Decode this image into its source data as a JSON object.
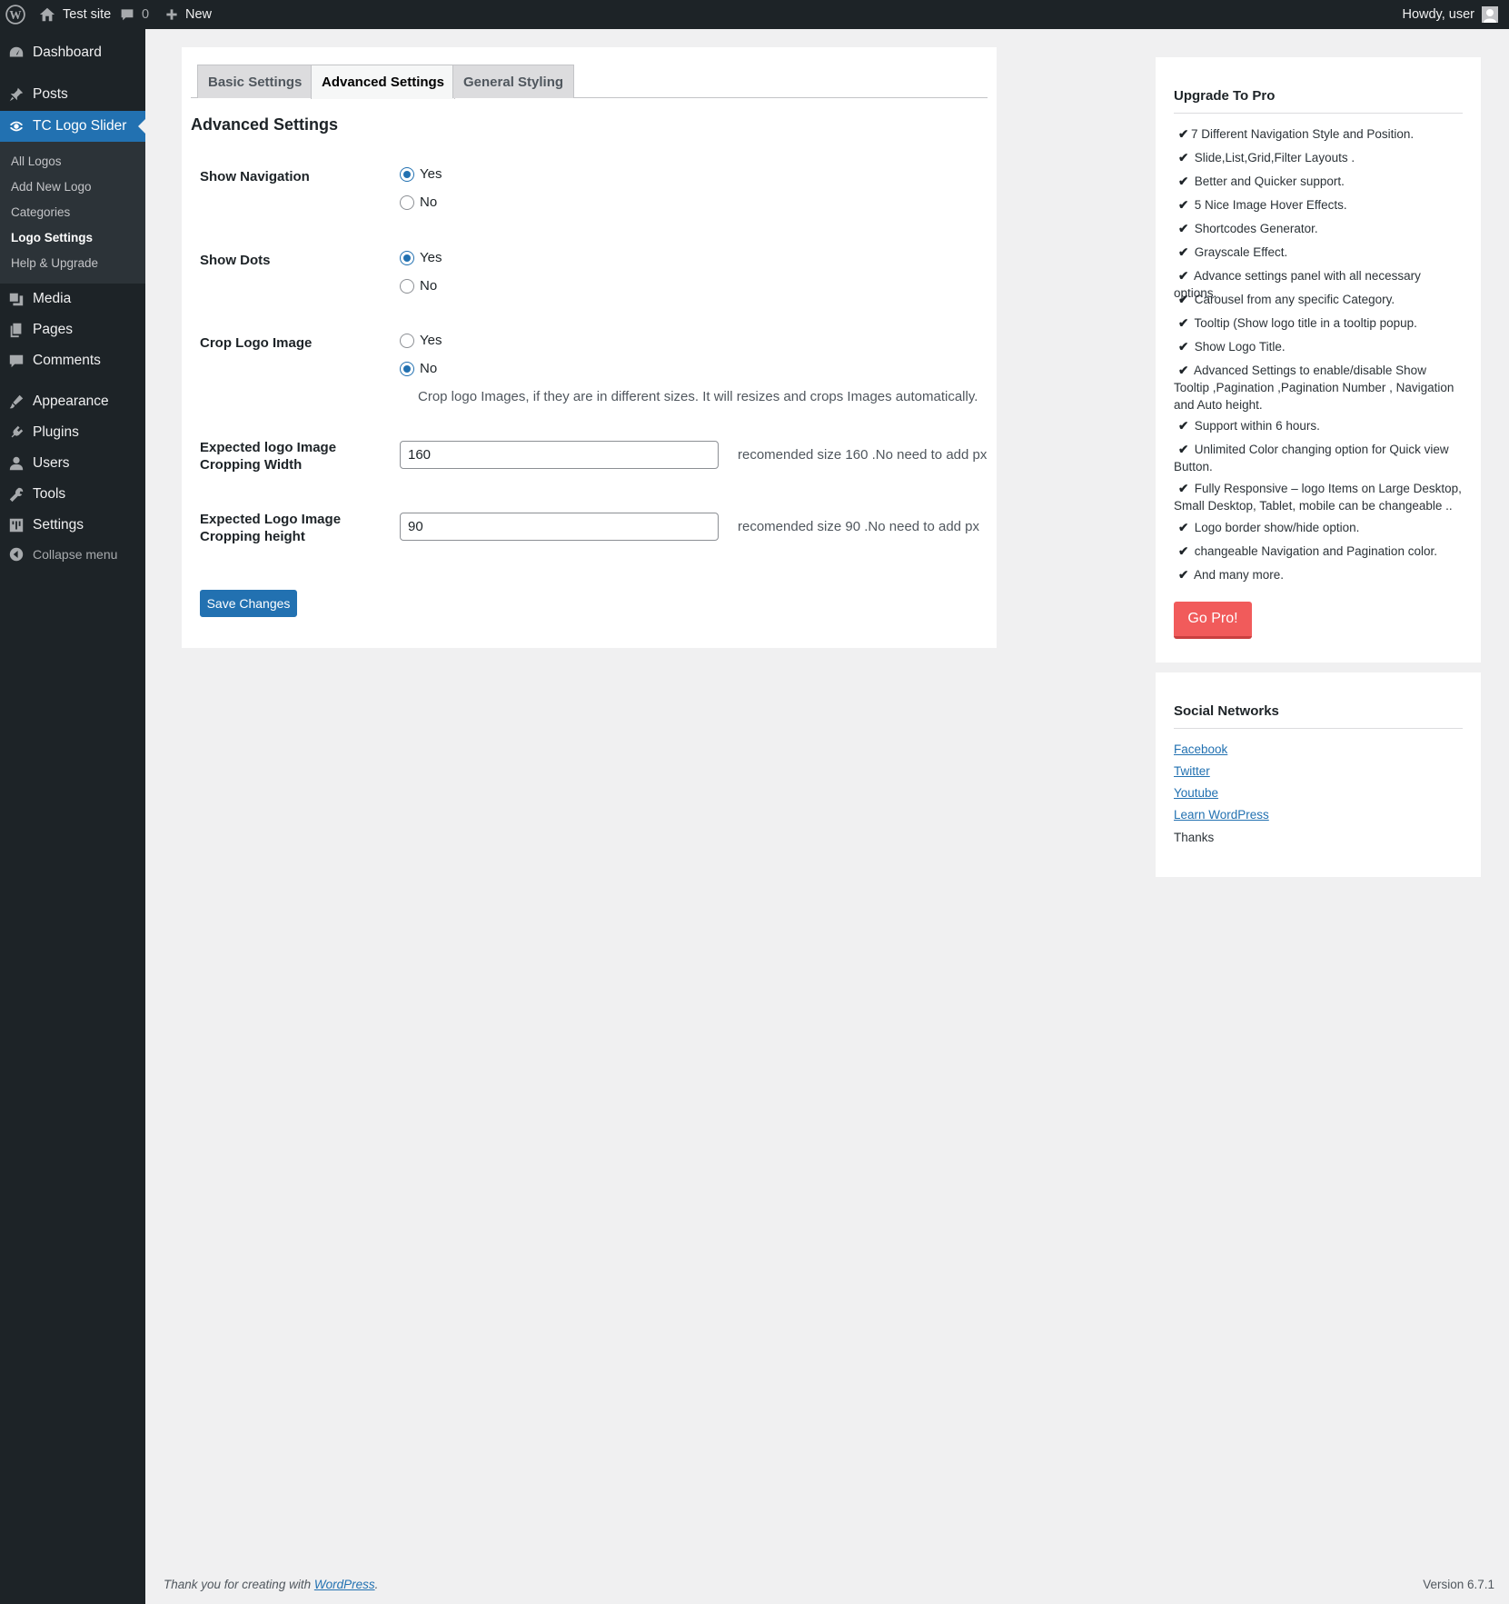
{
  "adminbar": {
    "site_name": "Test site",
    "comments_count": "0",
    "new_label": "New",
    "howdy": "Howdy, user"
  },
  "sidebar": {
    "items": [
      {
        "label": "Dashboard",
        "icon": "dashboard-icon"
      },
      {
        "label": "Posts",
        "icon": "pin-icon"
      },
      {
        "label": "TC Logo Slider",
        "icon": "slider-icon"
      },
      {
        "label": "Media",
        "icon": "media-icon"
      },
      {
        "label": "Pages",
        "icon": "pages-icon"
      },
      {
        "label": "Comments",
        "icon": "comments-icon"
      },
      {
        "label": "Appearance",
        "icon": "brush-icon"
      },
      {
        "label": "Plugins",
        "icon": "plugin-icon"
      },
      {
        "label": "Users",
        "icon": "user-icon"
      },
      {
        "label": "Tools",
        "icon": "wrench-icon"
      },
      {
        "label": "Settings",
        "icon": "settings-icon"
      }
    ],
    "submenu": [
      "All Logos",
      "Add New Logo",
      "Categories",
      "Logo Settings",
      "Help & Upgrade"
    ],
    "collapse_label": "Collapse menu"
  },
  "main": {
    "tabs": [
      "Basic Settings",
      "Advanced Settings",
      "General Styling"
    ],
    "section_title": "Advanced Settings",
    "show_navigation": {
      "label": "Show Navigation",
      "yes": "Yes",
      "no": "No",
      "selected": "Yes"
    },
    "show_dots": {
      "label": "Show Dots",
      "yes": "Yes",
      "no": "No",
      "selected": "Yes"
    },
    "crop_logo": {
      "label": "Crop Logo Image",
      "yes": "Yes",
      "no": "No",
      "selected": "No",
      "hint": "Crop logo Images, if they are in different sizes. It will resizes and crops Images automatically."
    },
    "crop_width": {
      "label_line1": "Expected logo Image",
      "label_line2": "Cropping Width",
      "value": "160",
      "hint": "recomended size 160 .No need to add px"
    },
    "crop_height": {
      "label_line1": "Expected Logo Image",
      "label_line2": "Cropping height",
      "value": "90",
      "hint": "recomended size 90 .No need to add px"
    },
    "save_label": "Save Changes"
  },
  "pro": {
    "title": "Upgrade To Pro",
    "features": [
      "7 Different Navigation Style and Position.",
      "Slide,List,Grid,Filter Layouts .",
      "Better and Quicker support.",
      "5 Nice Image Hover Effects.",
      "Shortcodes Generator.",
      "Grayscale Effect.",
      "Advance settings panel with all necessary options.",
      "Carousel from any specific Category.",
      "Tooltip (Show logo title in a tooltip popup.",
      "Show Logo Title.",
      "Advanced Settings to enable/disable Show Tooltip ,Pagination ,Pagination Number , Navigation and Auto height.",
      "Support within 6 hours.",
      "Unlimited Color changing option for Quick view Button.",
      "Fully Responsive – logo Items on Large Desktop, Small Desktop, Tablet, mobile can be changeable ..",
      "Logo border show/hide option.",
      "changeable Navigation and Pagination color.",
      "And many more."
    ],
    "button": "Go Pro!"
  },
  "social": {
    "title": "Social Networks",
    "links": [
      "Facebook",
      "Twitter",
      "Youtube",
      "Learn WordPress"
    ],
    "thanks": "Thanks"
  },
  "footer": {
    "thank_prefix": "Thank you for creating with ",
    "wp_link": "WordPress",
    "thank_suffix": ".",
    "version": "Version 6.7.1"
  },
  "colors": {
    "accent": "#2271b1",
    "adminbar": "#1d2327",
    "go_pro": "#f15b5b"
  }
}
